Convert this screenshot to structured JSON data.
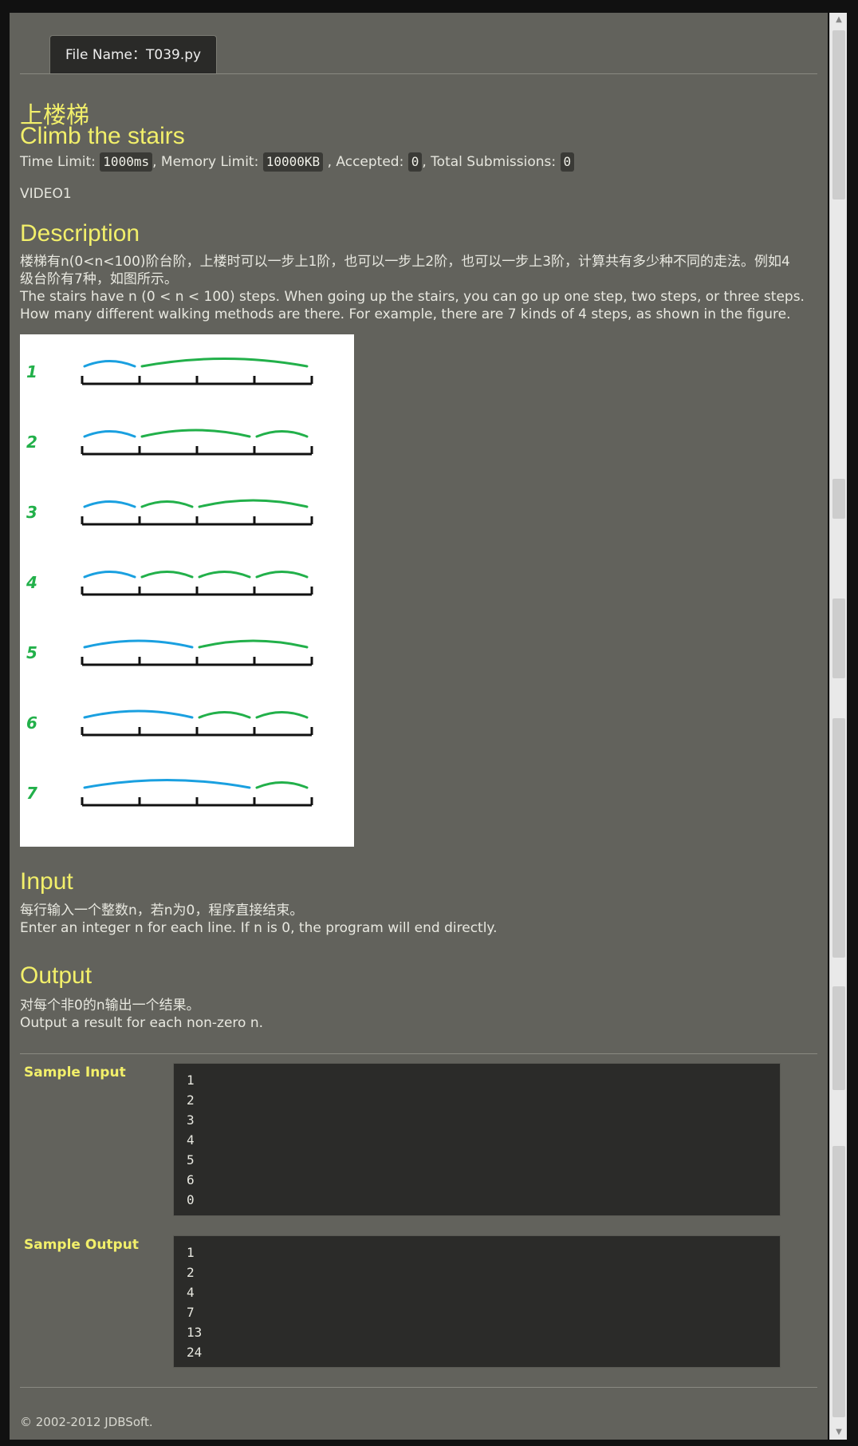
{
  "tab": {
    "file_label": "File Name：T039.py"
  },
  "problem": {
    "title_cn": "上楼梯",
    "title_en": "Climb the stairs",
    "time_limit_label": "Time Limit:",
    "time_limit": "1000ms",
    "memory_limit_label": ", Memory Limit:",
    "memory_limit": "10000KB",
    "accepted_label": ", Accepted:",
    "accepted": "0",
    "total_label": ", Total Submissions:",
    "total": "0",
    "video": "VIDEO1"
  },
  "description": {
    "heading": "Description",
    "cn_line1": "楼梯有n(0<n<100)阶台阶，上楼时可以一步上1阶，也可以一步上2阶，也可以一步上3阶，计算共有多少种不同的走法。例如4",
    "cn_line2": "级台阶有7种，如图所示。",
    "en_line1": "The stairs have n (0 < n < 100) steps. When going up the stairs, you can go up one step, two steps, or three steps.",
    "en_line2": "How many different walking methods are there. For example, there are 7 kinds of 4 steps, as shown in the figure.",
    "figure": {
      "rows": [
        {
          "label": "1",
          "jumps": [
            1,
            3
          ]
        },
        {
          "label": "2",
          "jumps": [
            1,
            2,
            1
          ]
        },
        {
          "label": "3",
          "jumps": [
            1,
            1,
            2
          ]
        },
        {
          "label": "4",
          "jumps": [
            1,
            1,
            1,
            1
          ]
        },
        {
          "label": "5",
          "jumps": [
            2,
            2
          ]
        },
        {
          "label": "6",
          "jumps": [
            2,
            1,
            1
          ]
        },
        {
          "label": "7",
          "jumps": [
            3,
            1
          ]
        }
      ],
      "first_jump_color": "#1aa0e0",
      "other_jump_color": "#22b04a",
      "label_color": "#22b04a"
    }
  },
  "input": {
    "heading": "Input",
    "cn": "每行输入一个整数n，若n为0，程序直接结束。",
    "en": "Enter an integer n for each line. If n is 0, the program will end directly."
  },
  "output": {
    "heading": "Output",
    "cn": "对每个非0的n输出一个结果。",
    "en": "Output a result for each non-zero n."
  },
  "sample_input": {
    "label": "Sample Input",
    "lines": [
      "1",
      "2",
      "3",
      "4",
      "5",
      "6",
      "0"
    ]
  },
  "sample_output": {
    "label": "Sample Output",
    "lines": [
      "1",
      "2",
      "4",
      "7",
      "13",
      "24"
    ]
  },
  "footer": "© 2002-2012  JDBSoft.",
  "colors": {
    "accent_heading": "#f2ef6a",
    "page_bg": "#62625c",
    "code_bg": "#2b2b29"
  }
}
